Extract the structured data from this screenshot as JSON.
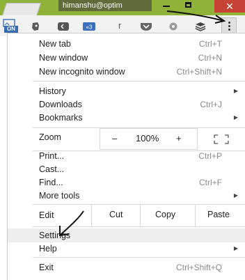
{
  "titlebar": {
    "profile_name": "himanshu@optim",
    "close_glyph": "✕"
  },
  "toolbar": {
    "on_badge": "ON",
    "r_icon_letter": "r",
    "icons": [
      "cast-icon",
      "evernote-icon",
      "pocket-icon",
      "feedly-icon",
      "gear-icon",
      "stack-icon",
      "chrome-menu-icon"
    ]
  },
  "menu": {
    "new_tab": {
      "label": "New tab",
      "shortcut": "Ctrl+T"
    },
    "new_window": {
      "label": "New window",
      "shortcut": "Ctrl+N"
    },
    "new_incognito": {
      "label": "New incognito window",
      "shortcut": "Ctrl+Shift+N"
    },
    "history": {
      "label": "History"
    },
    "downloads": {
      "label": "Downloads",
      "shortcut": "Ctrl+J"
    },
    "bookmarks": {
      "label": "Bookmarks"
    },
    "zoom": {
      "label": "Zoom",
      "minus": "–",
      "value": "100%",
      "plus": "+"
    },
    "print": {
      "label": "Print...",
      "shortcut": "Ctrl+P"
    },
    "cast": {
      "label": "Cast..."
    },
    "find": {
      "label": "Find...",
      "shortcut": "Ctrl+F"
    },
    "more_tools": {
      "label": "More tools"
    },
    "edit": {
      "label": "Edit",
      "cut": "Cut",
      "copy": "Copy",
      "paste": "Paste"
    },
    "settings": {
      "label": "Settings"
    },
    "help": {
      "label": "Help"
    },
    "exit": {
      "label": "Exit",
      "shortcut": "Ctrl+Shift+Q"
    },
    "submenu_arrow": "▶"
  },
  "colors": {
    "titlebar": "#8fb339",
    "close_button": "#c74335",
    "highlight": "#eeeeee"
  }
}
